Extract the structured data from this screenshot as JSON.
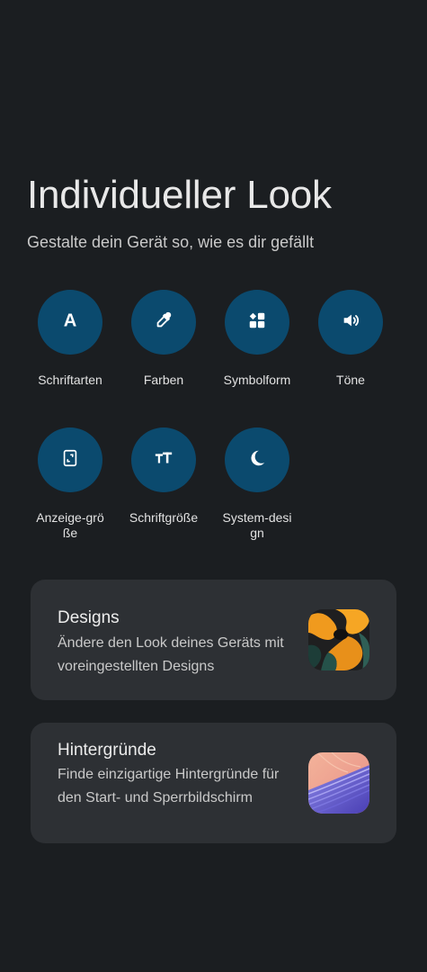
{
  "page": {
    "title": "Individueller Look",
    "subtitle": "Gestalte dein Gerät so, wie es dir gefällt"
  },
  "options": [
    {
      "label": "Schriftarten",
      "icon": "font-icon"
    },
    {
      "label": "Farben",
      "icon": "eyedropper-icon"
    },
    {
      "label": "Symbolform",
      "icon": "shapes-icon"
    },
    {
      "label": "Töne",
      "icon": "speaker-icon"
    },
    {
      "label": "Anzeige-größe",
      "icon": "display-size-icon"
    },
    {
      "label": "Schriftgröße",
      "icon": "text-size-icon"
    },
    {
      "label": "System-design",
      "icon": "moon-icon"
    }
  ],
  "cards": {
    "designs": {
      "title": "Designs",
      "description": "Ändere den Look deines Geräts mit voreingestellten Designs"
    },
    "wallpapers": {
      "title": "Hintergründe",
      "description": "Finde einzigartige Hintergründe für den Start- und Sperrbildschirm"
    }
  },
  "colors": {
    "background": "#1b1e21",
    "accent_circle": "#0b4a6e",
    "card": "#2d3034"
  }
}
